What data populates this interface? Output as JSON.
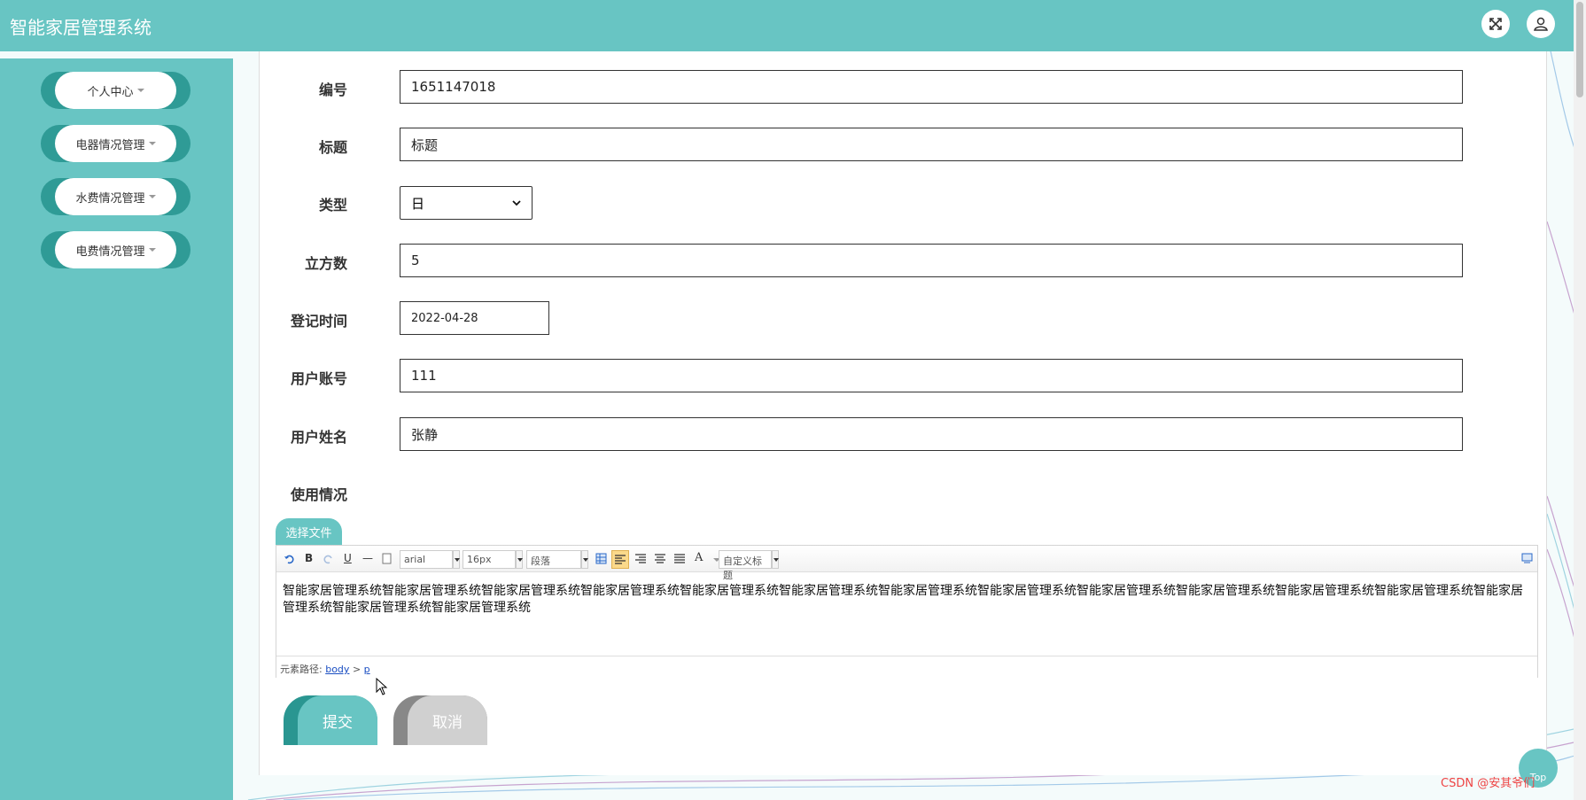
{
  "app": {
    "title": "智能家居管理系统"
  },
  "header": {
    "fullscreen_icon": "fullscreen-icon",
    "user_icon": "user-icon"
  },
  "sidebar": {
    "items": [
      {
        "label": "个人中心"
      },
      {
        "label": "电器情况管理"
      },
      {
        "label": "水费情况管理"
      },
      {
        "label": "电费情况管理"
      }
    ]
  },
  "form": {
    "number": {
      "label": "编号",
      "value": "1651147018"
    },
    "title": {
      "label": "标题",
      "value": "标题"
    },
    "type": {
      "label": "类型",
      "value": "日"
    },
    "volume": {
      "label": "立方数",
      "value": "5"
    },
    "reg_time": {
      "label": "登记时间",
      "value": "2022-04-28"
    },
    "account": {
      "label": "用户账号",
      "value": "111"
    },
    "username": {
      "label": "用户姓名",
      "value": "张静"
    },
    "usage": {
      "label": "使用情况"
    }
  },
  "editor": {
    "upload_label": "选择文件",
    "font": "arial",
    "size": "16px",
    "paragraph": "段落",
    "custom_title": "自定义标题",
    "content": "智能家居管理系统智能家居管理系统智能家居管理系统智能家居管理系统智能家居管理系统智能家居管理系统智能家居管理系统智能家居管理系统智能家居管理系统智能家居管理系统智能家居管理系统智能家居管理系统智能家居管理系统智能家居管理系统智能家居管理系统",
    "path_label": "元素路径:",
    "path_body": "body",
    "path_sep": ">",
    "path_p": "p"
  },
  "buttons": {
    "submit": "提交",
    "cancel": "取消"
  },
  "top_link": "Top",
  "watermark": "CSDN @安其爷们"
}
